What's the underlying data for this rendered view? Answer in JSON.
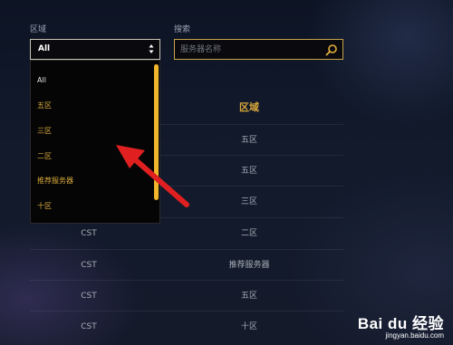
{
  "filters": {
    "region_label": "区域",
    "region_selected": "All",
    "search_label": "搜索",
    "search_placeholder": "服务器名称"
  },
  "table": {
    "header_region": "区域",
    "rows": [
      {
        "col1": "",
        "region": "五区"
      },
      {
        "col1": "",
        "region": "五区"
      },
      {
        "col1": "",
        "region": "三区"
      },
      {
        "col1": "CST",
        "region": "二区"
      },
      {
        "col1": "CST",
        "region": "推荐服务器"
      },
      {
        "col1": "CST",
        "region": "五区"
      },
      {
        "col1": "CST",
        "region": "十区"
      }
    ]
  },
  "dropdown": {
    "options": [
      "All",
      "五区",
      "三区",
      "二区",
      "推荐服务器",
      "十区"
    ]
  },
  "colors": {
    "accent_gold": "#d8a93a",
    "scrollbar": "#f1b62b",
    "arrow_red": "#e02020"
  },
  "watermark": {
    "logo_text": "Bai du 经验",
    "url": "jingyan.baidu.com"
  }
}
